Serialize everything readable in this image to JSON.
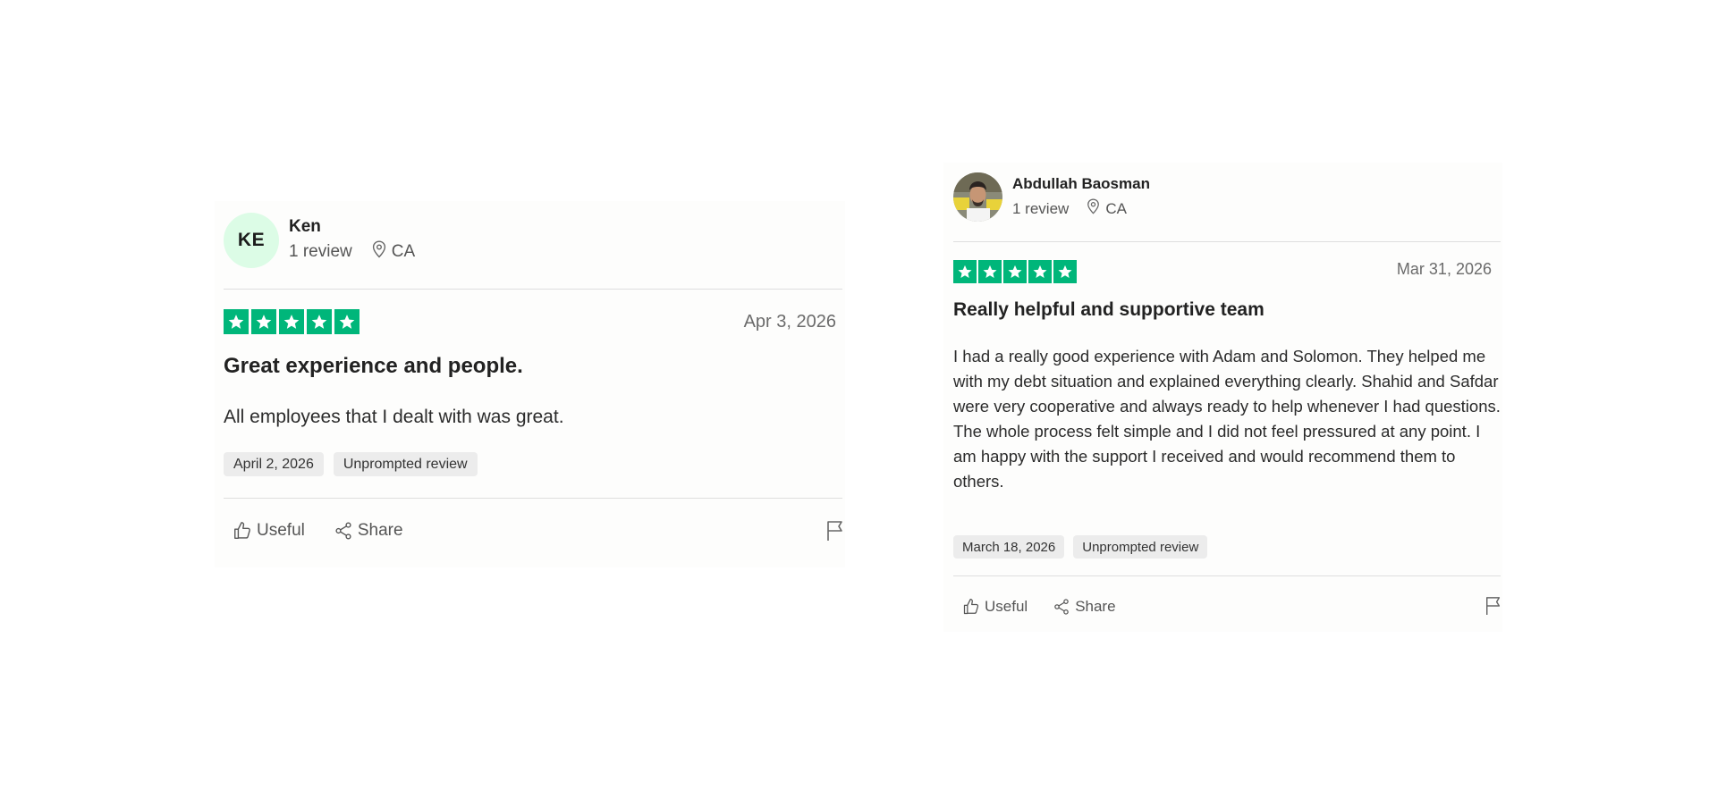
{
  "reviews": [
    {
      "reviewer": {
        "initials": "KE",
        "name": "Ken",
        "review_count": "1 review",
        "country": "CA",
        "avatar_bg": "#dcfce6"
      },
      "rating": 5,
      "date": "Apr 3, 2026",
      "title": "Great experience and people.",
      "body": [
        "All employees that I dealt with was great."
      ],
      "tags": [
        "April 2, 2026",
        "Unprompted review"
      ],
      "actions": {
        "useful": "Useful",
        "share": "Share"
      }
    },
    {
      "reviewer": {
        "name": "Abdullah Baosman",
        "review_count": "1 review",
        "country": "CA"
      },
      "rating": 5,
      "date": "Mar 31, 2026",
      "title": "Really helpful and supportive team",
      "body": [
        "I had a really good experience with Adam and Solomon. They helped me with my debt situation and explained everything clearly. Shahid and Safdar were very cooperative and always ready to help whenever I had questions.",
        "The whole process felt simple and I did not feel pressured at any point. I am happy with the support I received and would recommend them to others."
      ],
      "tags": [
        "March 18, 2026",
        "Unprompted review"
      ],
      "actions": {
        "useful": "Useful",
        "share": "Share"
      }
    }
  ],
  "colors": {
    "star_green": "#00b67a",
    "tag_bg": "#ececec",
    "divider": "#dedede"
  },
  "icons": [
    "location-pin-icon",
    "star-icon",
    "thumbs-up-icon",
    "share-icon",
    "flag-icon"
  ]
}
